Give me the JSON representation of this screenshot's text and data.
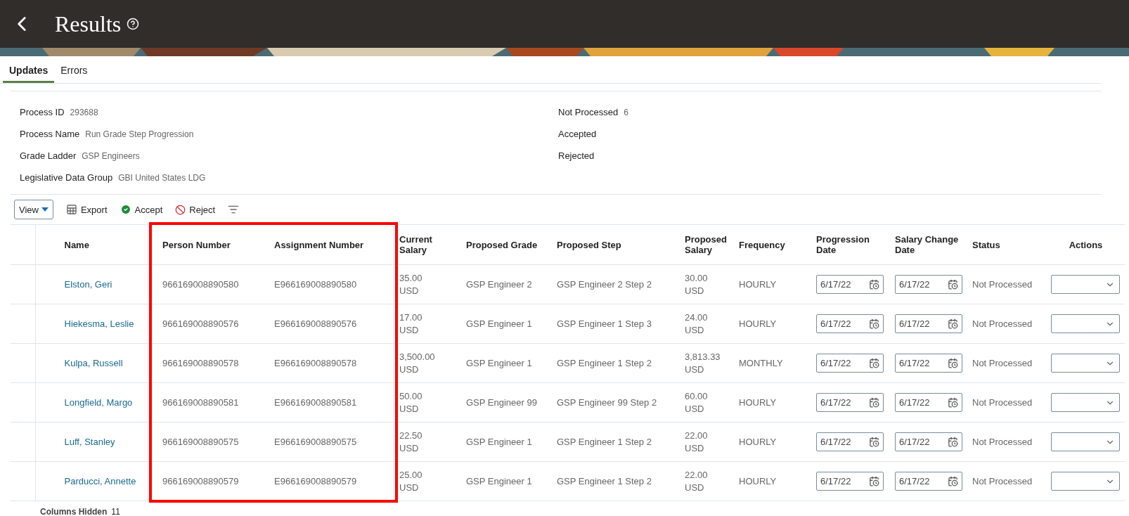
{
  "header": {
    "title": "Results"
  },
  "tabs": [
    {
      "label": "Updates",
      "selected": true
    },
    {
      "label": "Errors",
      "selected": false
    }
  ],
  "summary_left": [
    {
      "label": "Process ID",
      "value": "293688"
    },
    {
      "label": "Process Name",
      "value": "Run Grade Step Progression"
    },
    {
      "label": "Grade Ladder",
      "value": "GSP Engineers"
    },
    {
      "label": "Legislative Data Group",
      "value": "GBI United States LDG"
    }
  ],
  "summary_right": [
    {
      "label": "Not Processed",
      "value": "6"
    },
    {
      "label": "Accepted"
    },
    {
      "label": "Rejected"
    }
  ],
  "toolbar": {
    "view": "View",
    "buttons": [
      {
        "kind": "export",
        "label": "Export"
      },
      {
        "kind": "accept",
        "label": "Accept"
      },
      {
        "kind": "reject",
        "label": "Reject"
      },
      {
        "kind": "filter"
      }
    ]
  },
  "table": {
    "columns": [
      {
        "label": "Name",
        "kind": "link",
        "highlighted": false
      },
      {
        "label": "Person Number",
        "kind": "text",
        "highlighted": true
      },
      {
        "label": "Assignment Number",
        "kind": "text",
        "highlighted": true
      },
      {
        "label": "Current Salary",
        "kind": "money",
        "highlighted": false
      },
      {
        "label": "Proposed Grade",
        "kind": "text",
        "highlighted": false
      },
      {
        "label": "Proposed Step",
        "kind": "text",
        "highlighted": false
      },
      {
        "label": "Proposed Salary",
        "kind": "money",
        "highlighted": false
      },
      {
        "label": "Frequency",
        "kind": "text",
        "highlighted": false
      },
      {
        "label": "Progression Date",
        "kind": "date",
        "highlighted": false
      },
      {
        "label": "Salary Change Date",
        "kind": "date",
        "highlighted": false
      },
      {
        "label": "Status",
        "kind": "text",
        "highlighted": false
      },
      {
        "label": "Actions",
        "kind": "select",
        "highlighted": false
      }
    ],
    "rows": [
      {
        "cells": [
          "Elston, Geri",
          "966169008890580",
          "E966169008890580",
          "35.00 USD",
          "GSP Engineer 2",
          "GSP Engineer 2 Step 2",
          "30.00 USD",
          "HOURLY",
          "6/17/22",
          "6/17/22",
          "Not Processed",
          ""
        ]
      },
      {
        "cells": [
          "Hiekesma, Leslie",
          "966169008890576",
          "E966169008890576",
          "17.00 USD",
          "GSP Engineer 1",
          "GSP Engineer 1 Step 3",
          "24.00 USD",
          "HOURLY",
          "6/17/22",
          "6/17/22",
          "Not Processed",
          ""
        ]
      },
      {
        "cells": [
          "Kulpa, Russell",
          "966169008890578",
          "E966169008890578",
          "3,500.00 USD",
          "GSP Engineer 1",
          "GSP Engineer 1 Step 2",
          "3,813.33 USD",
          "MONTHLY",
          "6/17/22",
          "6/17/22",
          "Not Processed",
          ""
        ]
      },
      {
        "cells": [
          "Longfield, Margo",
          "966169008890581",
          "E966169008890581",
          "50.00 USD",
          "GSP Engineer 99",
          "GSP Engineer 99 Step 2",
          "60.00 USD",
          "HOURLY",
          "6/17/22",
          "6/17/22",
          "Not Processed",
          ""
        ]
      },
      {
        "cells": [
          "Luff, Stanley",
          "966169008890575",
          "E966169008890575",
          "22.50 USD",
          "GSP Engineer 1",
          "GSP Engineer 1 Step 2",
          "22.00 USD",
          "HOURLY",
          "6/17/22",
          "6/17/22",
          "Not Processed",
          ""
        ]
      },
      {
        "cells": [
          "Parducci, Annette",
          "966169008890579",
          "E966169008890579",
          "25.00 USD",
          "GSP Engineer 1",
          "GSP Engineer 1 Step 2",
          "22.00 USD",
          "HOURLY",
          "6/17/22",
          "6/17/22",
          "Not Processed",
          ""
        ]
      }
    ]
  },
  "footer": {
    "label": "Columns Hidden",
    "value": "11"
  }
}
